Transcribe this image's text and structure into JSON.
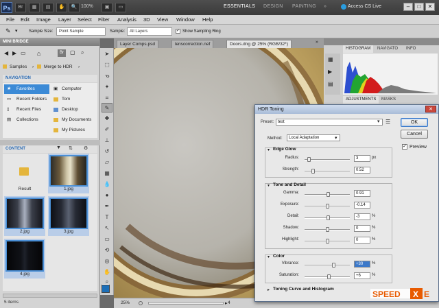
{
  "appbar": {
    "logo": "Ps",
    "zoom": "100%",
    "workspaces": [
      "ESSENTIALS",
      "DESIGN",
      "PAINTING"
    ],
    "more": "»",
    "cslive": "Access CS Live",
    "window_buttons": [
      "–",
      "□",
      "✕"
    ]
  },
  "menus": [
    "File",
    "Edit",
    "Image",
    "Layer",
    "Select",
    "Filter",
    "Analysis",
    "3D",
    "View",
    "Window",
    "Help"
  ],
  "options_bar": {
    "sample_size_label": "Sample Size:",
    "sample_size_value": "Point Sample",
    "sample_label": "Sample:",
    "sample_value": "All Layers",
    "show_ring_label": "Show Sampling Ring"
  },
  "mini_bridge": {
    "title": "MINI BRIDGE",
    "path": [
      "Samples",
      "Merge to HDR"
    ],
    "navigation_title": "NAVIGATION",
    "left_items": [
      "Favorites",
      "Recent Folders",
      "Recent Files",
      "Collections"
    ],
    "right_items": [
      "Computer",
      "Tom",
      "Desktop",
      "My Documents",
      "My Pictures"
    ],
    "content_title": "CONTENT",
    "thumbs": [
      "Result",
      "1.jpg",
      "2.jpg",
      "3.jpg",
      "4.jpg"
    ],
    "count": "5 items"
  },
  "doc_tabs": [
    "Layer Comps.psd",
    "lenscorrection.nef",
    "Doors.dng @ 25% (RGB/32*)"
  ],
  "statusbar": {
    "zoom": "25%",
    "page": "4"
  },
  "right_panel": {
    "tabs_top": [
      "HISTOGRAM",
      "NAVIGATO",
      "INFO"
    ],
    "tabs_bottom": [
      "ADJUSTMENTS",
      "MASKS"
    ]
  },
  "dialog": {
    "title": "HDR Toning",
    "preset_label": "Preset:",
    "preset_value": "test",
    "method_label": "Method:",
    "method_value": "Local Adaptation",
    "ok": "OK",
    "cancel": "Cancel",
    "preview": "Preview",
    "edge_glow": {
      "title": "Edge Glow",
      "radius_label": "Radius:",
      "radius": "3",
      "radius_unit": "px",
      "strength_label": "Strength:",
      "strength": "0.52"
    },
    "tone_detail": {
      "title": "Tone and Detail",
      "gamma_label": "Gamma:",
      "gamma": "0.91",
      "exposure_label": "Exposure:",
      "exposure": "-0.14",
      "detail_label": "Detail:",
      "detail": "-3",
      "detail_unit": "%",
      "shadow_label": "Shadow:",
      "shadow": "0",
      "shadow_unit": "%",
      "highlight_label": "Highlight:",
      "highlight": "0",
      "highlight_unit": "%"
    },
    "color": {
      "title": "Color",
      "vibrance_label": "Vibrance:",
      "vibrance": "+30",
      "vibrance_unit": "%",
      "saturation_label": "Saturation:",
      "saturation": "+6",
      "saturation_unit": "%"
    },
    "curve_title": "Toning Curve and Histogram"
  },
  "watermark": "SPEEDXE"
}
